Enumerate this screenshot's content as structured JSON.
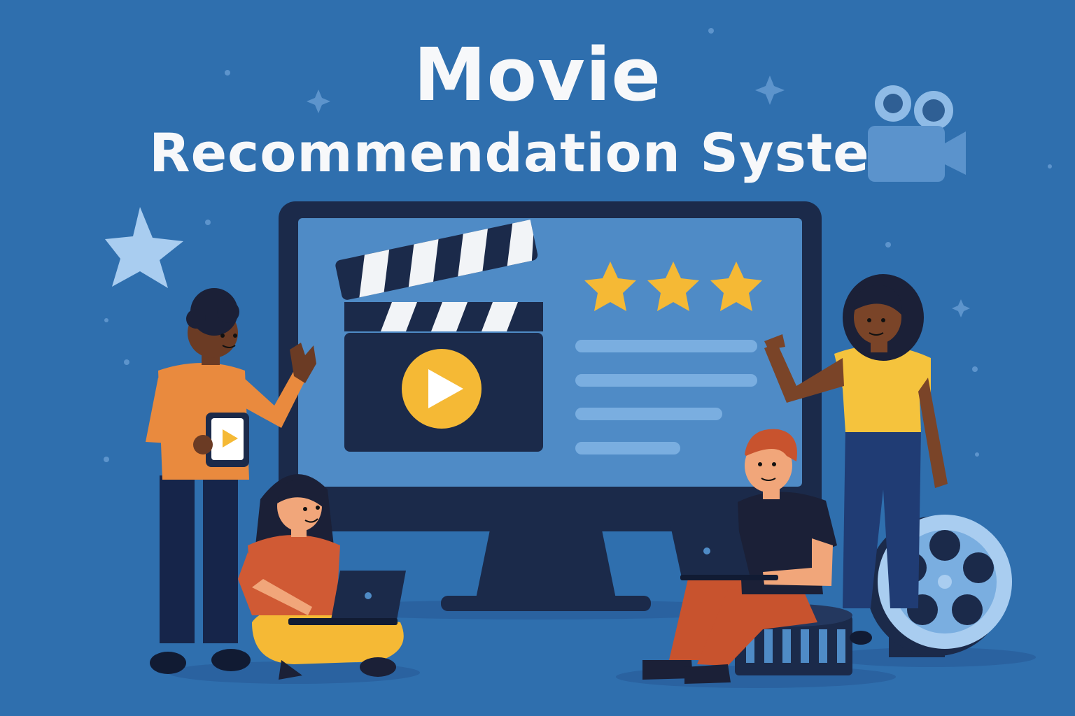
{
  "title": {
    "line1": "Movie",
    "line2": "Recommendation System"
  },
  "rating": {
    "stars_filled": 3
  },
  "colors": {
    "background": "#2f6fae",
    "screen": "#4f8bc6",
    "monitor_frame": "#1b2a4a",
    "star": "#f5b935",
    "play_button": "#f5b935",
    "text_lines": "#7aaee0",
    "title_text": "#f7f8fa"
  },
  "icons": [
    "clapperboard-icon",
    "play-icon",
    "star-icon",
    "film-reel-icon",
    "movie-camera-icon",
    "laptop-icon",
    "tablet-icon",
    "sparkle-icon"
  ]
}
